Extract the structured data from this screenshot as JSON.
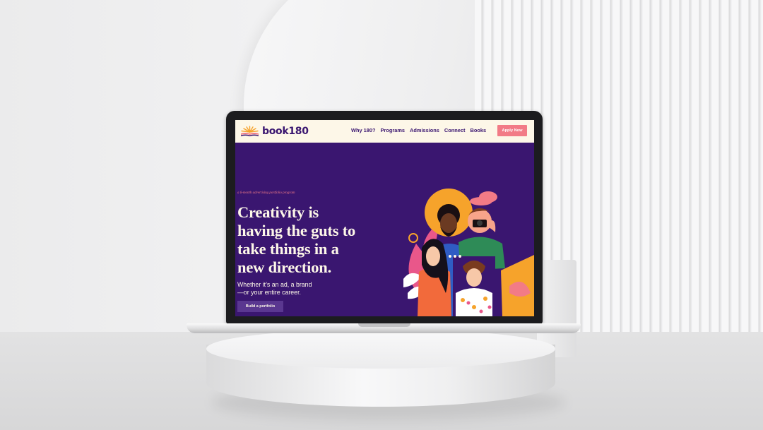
{
  "site": {
    "logo_text": "book180",
    "nav": [
      "Why 180?",
      "Programs",
      "Admissions",
      "Connect",
      "Books"
    ],
    "apply_label": "Apply Now"
  },
  "hero": {
    "kicker": "a 6-month advertising portfolio program",
    "headline_lines": [
      "Creativity is",
      "having the guts to",
      "take things in a",
      "new direction."
    ],
    "sub_lines": [
      "Whether it’s an ad, a brand",
      "—or your entire career."
    ],
    "cta_label": "Build a portfolio"
  },
  "colors": {
    "brand_purple": "#3a1670",
    "cream": "#fdf7e8",
    "coral": "#f27b86",
    "orange": "#f6a32b"
  },
  "icons": [
    "sunrise-logo-icon"
  ]
}
